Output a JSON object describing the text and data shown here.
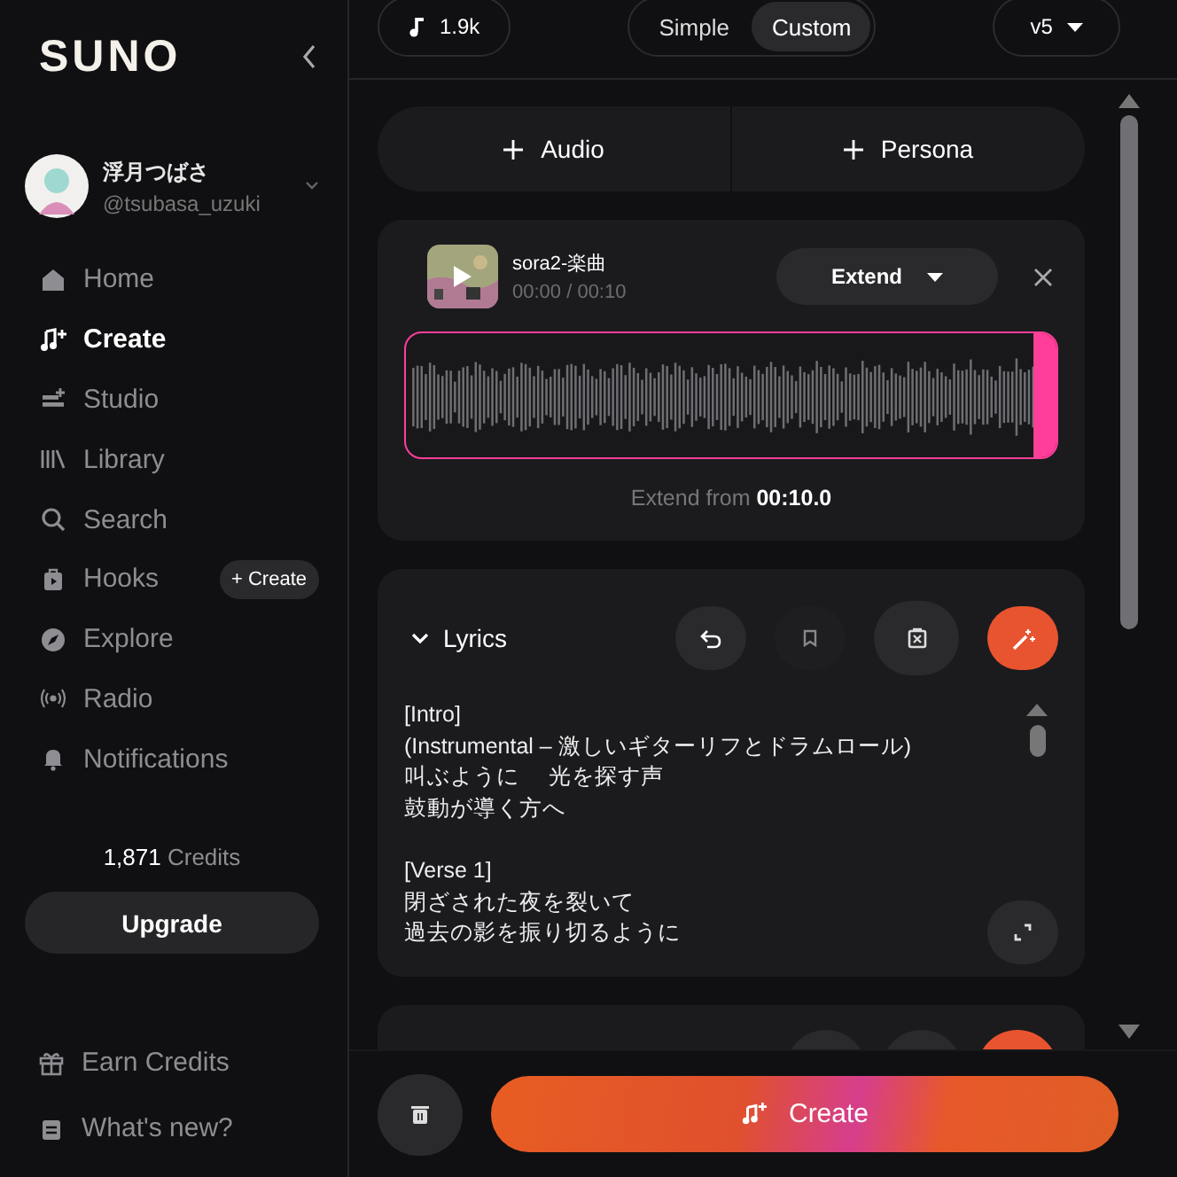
{
  "brand": {
    "logo": "SUNO"
  },
  "user": {
    "name": "浮月つばさ",
    "handle": "@tsubasa_uzuki"
  },
  "nav": [
    {
      "label": "Home",
      "kind": "home",
      "selected": false
    },
    {
      "label": "Create",
      "kind": "create",
      "selected": true
    },
    {
      "label": "Studio",
      "kind": "studio",
      "selected": false
    },
    {
      "label": "Library",
      "kind": "library",
      "selected": false
    },
    {
      "label": "Search",
      "kind": "search",
      "selected": false
    },
    {
      "label": "Hooks",
      "kind": "hooks",
      "selected": false,
      "badge": "+ Create"
    },
    {
      "label": "Explore",
      "kind": "explore",
      "selected": false
    },
    {
      "label": "Radio",
      "kind": "radio",
      "selected": false
    },
    {
      "label": "Notifications",
      "kind": "bell",
      "selected": false
    }
  ],
  "credits": {
    "amount": "1,871",
    "label": "Credits"
  },
  "upgrade": "Upgrade",
  "footer_links": [
    {
      "label": "Earn Credits",
      "kind": "gift"
    },
    {
      "label": "What's new?",
      "kind": "news"
    }
  ],
  "topbar": {
    "count": "1.9k",
    "modes": [
      {
        "label": "Simple",
        "selected": false
      },
      {
        "label": "Custom",
        "selected": true
      }
    ],
    "model": "v5"
  },
  "add_buttons": [
    "Audio",
    "Persona"
  ],
  "track": {
    "title": "sora2-楽曲",
    "time": "00:00 / 00:10",
    "action": "Extend",
    "extend_label": "Extend from",
    "extend_time": "00:10.0"
  },
  "lyrics": {
    "title": "Lyrics",
    "expanded": true,
    "stanzas": [
      [
        "[Intro]",
        "(Instrumental – 激しいギターリフとドラムロール)",
        "叫ぶように　 光を探す声",
        "鼓動が導く方へ"
      ],
      [
        "[Verse 1]",
        "閉ざされた夜を裂いて",
        "過去の影を振り切るように"
      ]
    ]
  },
  "create_button": "Create"
}
